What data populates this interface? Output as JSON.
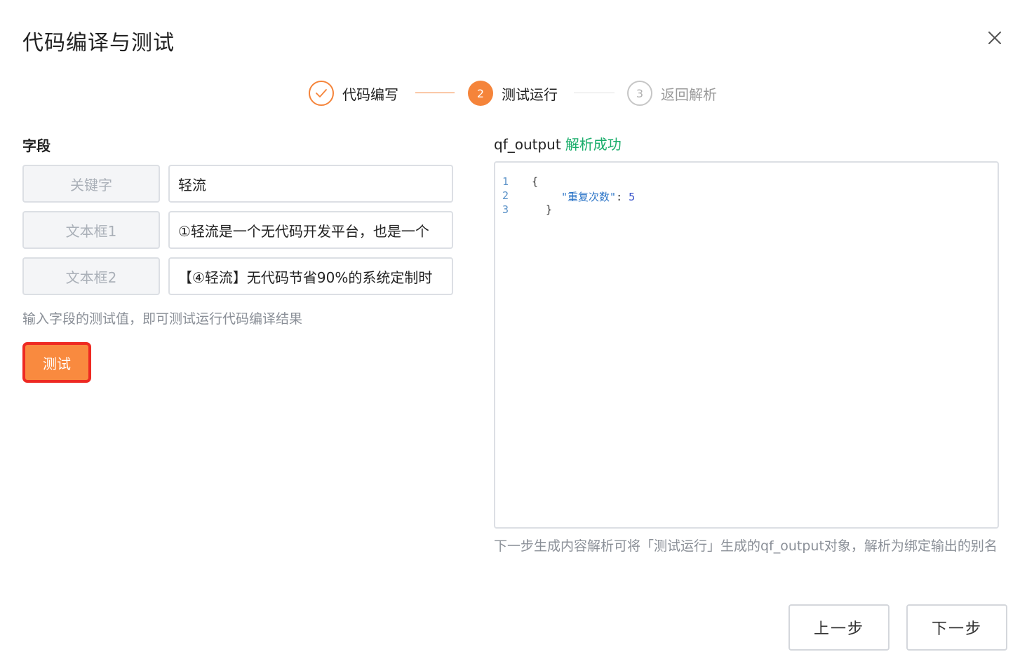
{
  "dialog": {
    "title": "代码编译与测试"
  },
  "steps": [
    {
      "label": "代码编写",
      "status": "done"
    },
    {
      "number": "2",
      "label": "测试运行",
      "status": "active"
    },
    {
      "number": "3",
      "label": "返回解析",
      "status": "wait"
    }
  ],
  "fields": {
    "heading": "字段",
    "rows": [
      {
        "key": "关键字",
        "value": "轻流"
      },
      {
        "key": "文本框1",
        "value": "①轻流是一个无代码开发平台，也是一个"
      },
      {
        "key": "文本框2",
        "value": "【④轻流】无代码节省90%的系统定制时"
      }
    ],
    "hint": "输入字段的测试值，即可测试运行代码编译结果",
    "test_button": "测试"
  },
  "output": {
    "name": "qf_output",
    "status": "解析成功",
    "code_lines": [
      {
        "num": "1",
        "text": "{"
      },
      {
        "num": "2",
        "key": "\"重复次数\"",
        "sep": ": ",
        "value": "5"
      },
      {
        "num": "3",
        "text": "}"
      }
    ],
    "hint": "下一步生成内容解析可将「测试运行」生成的qf_output对象，解析为绑定输出的别名"
  },
  "footer": {
    "prev_label": "上一步",
    "next_label": "下一步"
  },
  "colors": {
    "accent": "#f5843a",
    "success": "#1aad6b",
    "highlight_border": "#ee2a22"
  }
}
